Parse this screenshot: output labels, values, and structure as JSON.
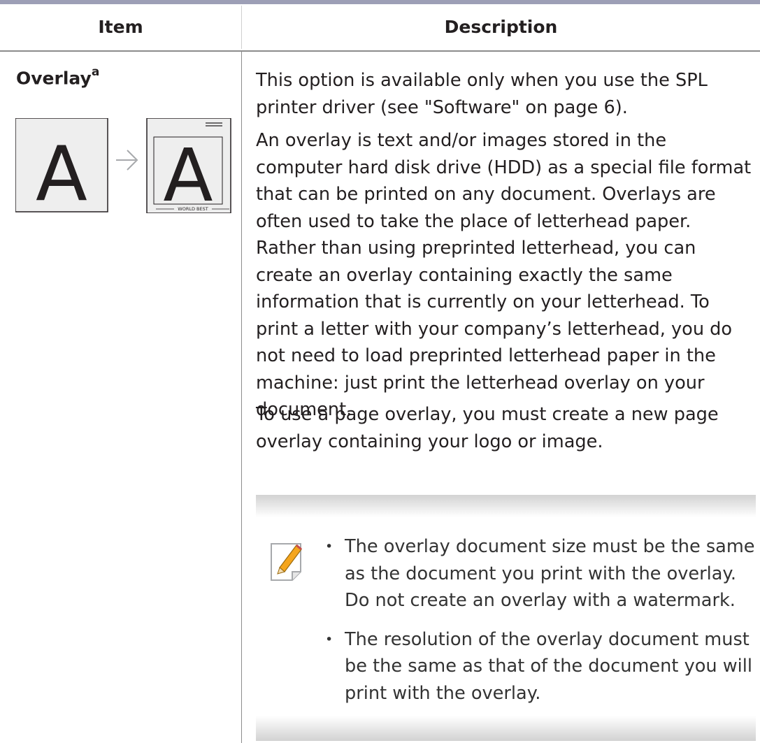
{
  "table": {
    "header": {
      "item": "Item",
      "description": "Description"
    },
    "row": {
      "item_name": "Overlay",
      "item_footnote": "a",
      "illustration": {
        "before_letter": "A",
        "after_letter": "A",
        "footer_text": "WORLD BEST",
        "arrow_icon": "arrow-right-icon"
      },
      "paragraphs": [
        "This option is available only when you use the SPL printer driver (see \"Software\" on page 6).",
        "An overlay is text and/or images stored in the computer hard disk drive (HDD) as a special file format that can be printed on any document. Overlays are often used to take the place of letterhead paper. Rather than using preprinted letterhead, you can create an overlay containing exactly the same information that is currently on your letterhead. To print a letter with your company’s letterhead, you do not need to load preprinted letterhead paper in the machine: just print the letterhead overlay on your document.",
        "To use a page overlay, you must create a new page overlay containing your logo or image."
      ],
      "note": {
        "icon": "note-pencil-icon",
        "bullet_glyph": "•",
        "items": [
          "The overlay document size must be the same as the document you print with the overlay. Do not create an overlay with a watermark.",
          "The resolution of the overlay document must be the same as that of the document you will print with the overlay."
        ]
      }
    }
  },
  "colors": {
    "top_rule": "#9d9fb6",
    "text": "#231f20",
    "note_text": "#333333",
    "note_gradient": "#d2d2d2",
    "icon_accent": "#f5a51c",
    "illustration_page": "#eeeeee"
  }
}
